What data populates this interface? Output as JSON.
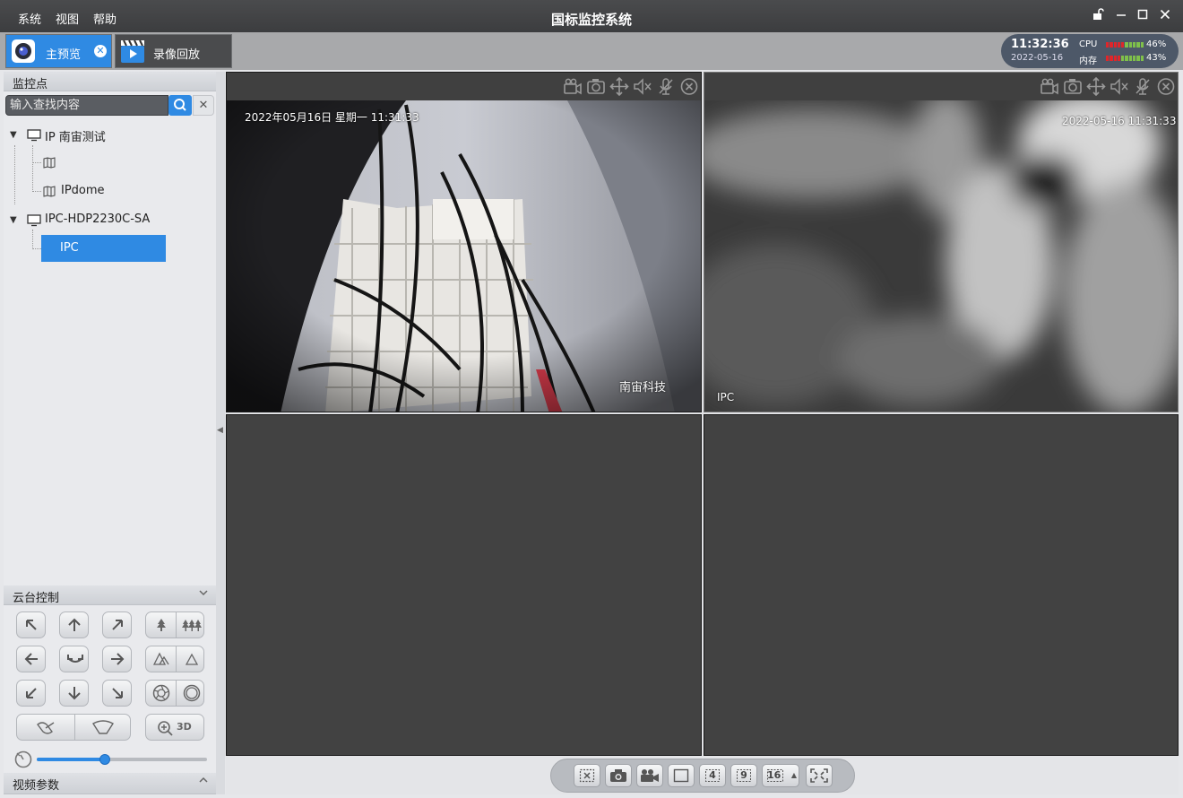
{
  "menu": [
    "系统",
    "视图",
    "帮助"
  ],
  "app_title": "国标监控系统",
  "tabs": {
    "preview_label": "主预览",
    "playback_label": "录像回放"
  },
  "status": {
    "time": "11:32:36",
    "date": "2022-05-16",
    "cpu_label": "CPU",
    "cpu_value": "46%",
    "cpu_fraction": 0.46,
    "mem_label": "内存",
    "mem_value": "43%",
    "mem_fraction": 0.43
  },
  "sidebar": {
    "monitor_header": "监控点",
    "search_placeholder": "输入查找内容",
    "tree": [
      {
        "label": "IP 南宙测试",
        "level": 0
      },
      {
        "label": "",
        "level": 1
      },
      {
        "label": "IPdome",
        "level": 1
      },
      {
        "label": "IPC-HDP2230C-SA",
        "level": 0
      },
      {
        "label": "IPC",
        "level": 1,
        "selected": true
      }
    ],
    "ptz_header": "云台控制",
    "ptz_3d_label": "3D",
    "ptz_speed": 0.4,
    "video_params_header": "视频参数"
  },
  "panes": [
    {
      "osd_datetime": "2022年05月16日  星期一  11:31:33",
      "osd_name": "南宙科技"
    },
    {
      "osd_datetime": "2022-05-16 11:31:33",
      "osd_name": "IPC"
    },
    {},
    {}
  ],
  "bottom_toolbar": {
    "layout_4": "4",
    "layout_9": "9",
    "layout_16": "16"
  },
  "colors": {
    "accent": "#2f8ae3",
    "titlebar": "#3c3d3f",
    "pane_bg": "#424242"
  }
}
